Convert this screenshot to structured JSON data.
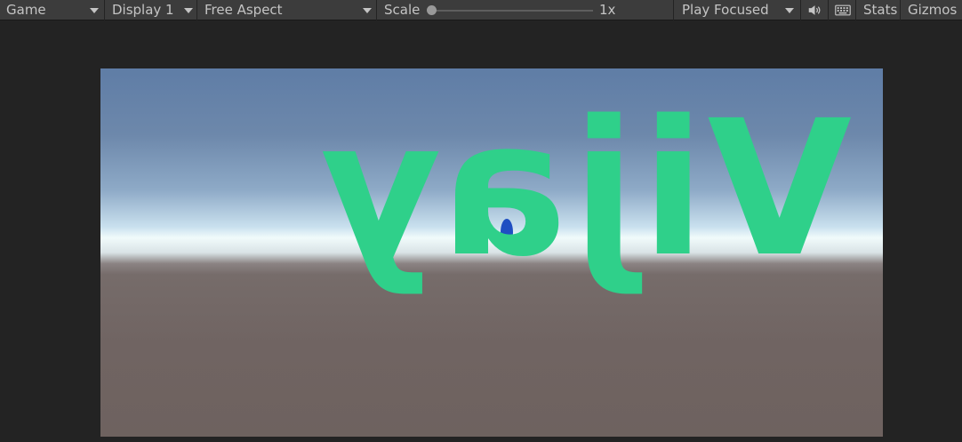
{
  "toolbar": {
    "view_label": "Game",
    "display_label": "Display 1",
    "aspect_label": "Free Aspect",
    "scale_label": "Scale",
    "scale_value": "1x",
    "play_mode_label": "Play Focused",
    "audio_icon": "speaker-icon",
    "keyboard_icon": "keyboard-icon",
    "stats_label": "Stats",
    "gizmos_label": "Gizmos"
  },
  "game": {
    "world_text": "Vijay"
  },
  "colors": {
    "toolbar_bg": "#3c3c3c",
    "editor_bg": "#232323",
    "text_color": "#2fd08a",
    "ball_color": "#1f4fc2"
  }
}
